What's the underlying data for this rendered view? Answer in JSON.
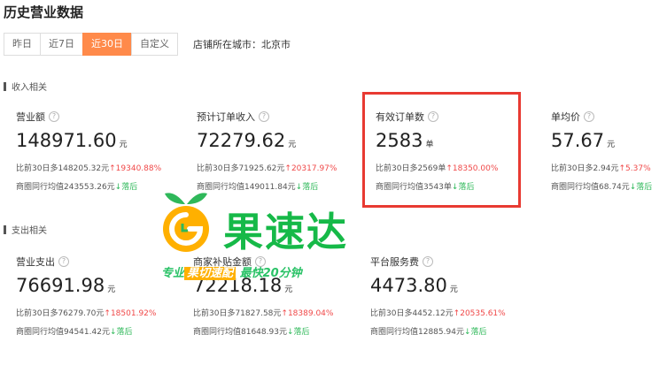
{
  "page": {
    "title": "历史营业数据"
  },
  "tabs": [
    {
      "label": "昨日"
    },
    {
      "label": "近7日"
    },
    {
      "label": "近30日",
      "active": true
    },
    {
      "label": "自定义"
    }
  ],
  "store_city": "店铺所在城市：北京市",
  "income": {
    "section_label": "收入相关",
    "metrics": [
      {
        "label": "营业额",
        "value": "148971.60",
        "unit": "元",
        "cmp_text": "比前30日多148205.32元",
        "cmp_pct": "↑19340.88%",
        "avg_text": "商圈同行均值243553.26元",
        "avg_trend": "↓落后"
      },
      {
        "label": "预计订单收入",
        "value": "72279.62",
        "unit": "元",
        "cmp_text": "比前30日多71925.62元",
        "cmp_pct": "↑20317.97%",
        "avg_text": "商圈同行均值149011.84元",
        "avg_trend": "↓落后"
      },
      {
        "label": "有效订单数",
        "value": "2583",
        "unit": "单",
        "cmp_text": "比前30日多2569单",
        "cmp_pct": "↑18350.00%",
        "avg_text": "商圈同行均值3543单",
        "avg_trend": "↓落后"
      },
      {
        "label": "单均价",
        "value": "57.67",
        "unit": "元",
        "cmp_text": "比前30日多2.94元",
        "cmp_pct": "↑5.37%",
        "avg_text": "商圈同行均值68.74元",
        "avg_trend": "↓落后"
      }
    ]
  },
  "expense": {
    "section_label": "支出相关",
    "metrics": [
      {
        "label": "营业支出",
        "value": "76691.98",
        "unit": "元",
        "cmp_text": "比前30日多76279.70元",
        "cmp_pct": "↑18501.92%",
        "avg_text": "商圈同行均值94541.42元",
        "avg_trend": "↓落后"
      },
      {
        "label": "商家补贴金额",
        "value": "72218.18",
        "unit": "元",
        "cmp_text": "比前30日多71827.58元",
        "cmp_pct": "↑18389.04%",
        "avg_text": "商圈同行均值81648.93元",
        "avg_trend": "↓落后"
      },
      {
        "label": "平台服务费",
        "value": "4473.80",
        "unit": "元",
        "cmp_text": "比前30日多4452.12元",
        "cmp_pct": "↑20535.61%",
        "avg_text": "商圈同行均值12885.94元",
        "avg_trend": "↓落后"
      }
    ]
  },
  "watermark": {
    "brand": "果速达",
    "slogan_pre": "专业",
    "slogan_hl": "果切速配",
    "slogan_post": "最快20分钟"
  },
  "colors": {
    "accent": "#ff8a4a",
    "up": "#f04848",
    "down": "#2fb85a",
    "highlight_box": "#e83a32",
    "watermark_green": "#16b948"
  }
}
